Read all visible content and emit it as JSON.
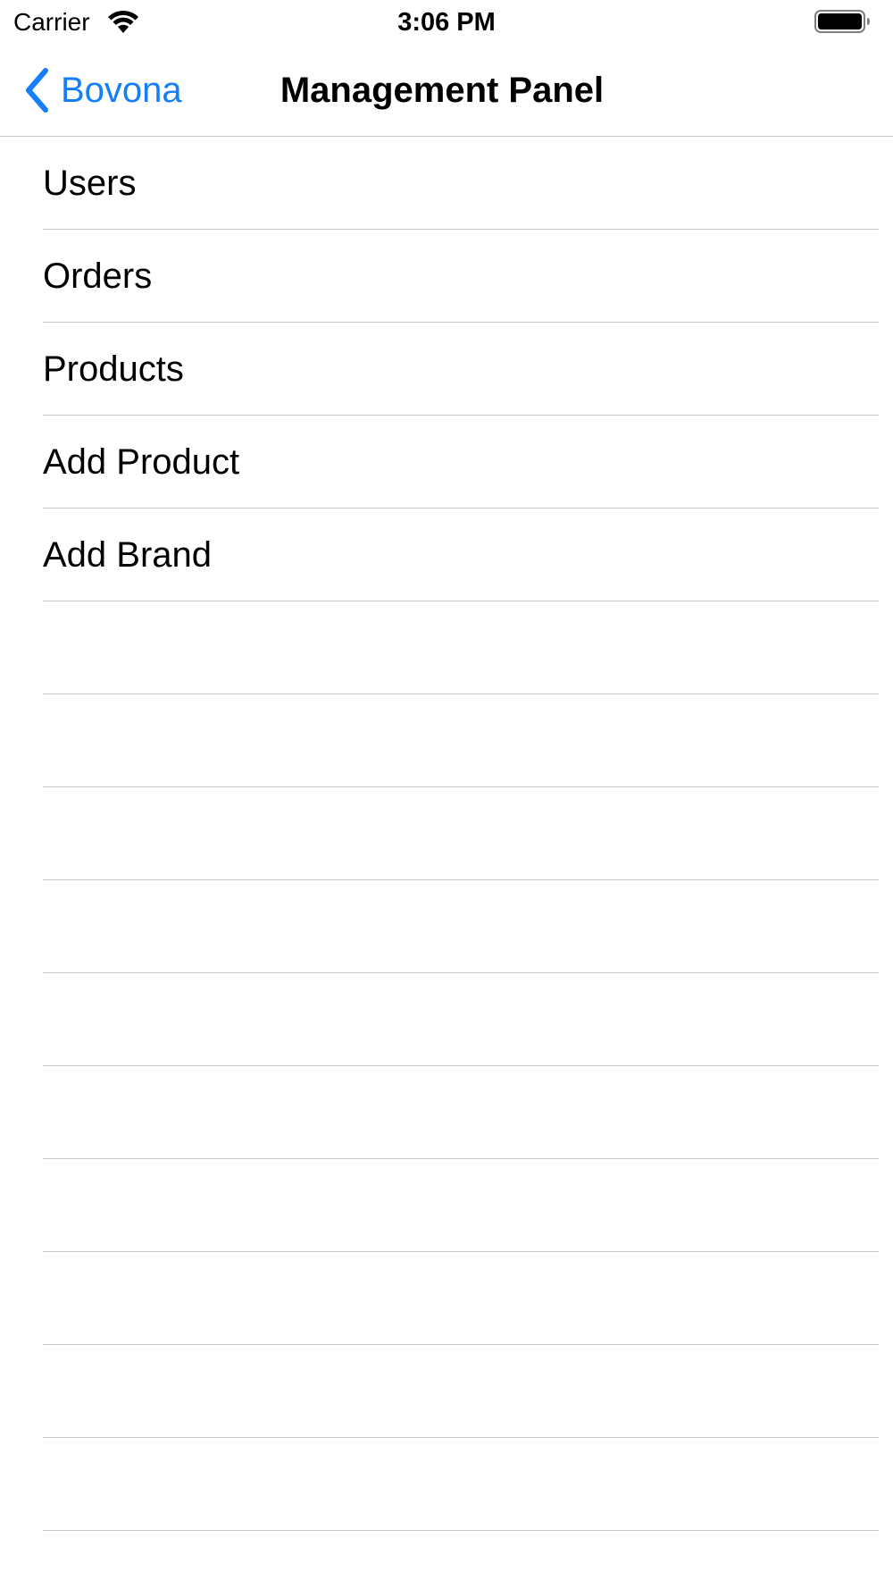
{
  "status_bar": {
    "carrier": "Carrier",
    "time": "3:06 PM",
    "icons": [
      "wifi-icon",
      "battery-icon"
    ]
  },
  "nav": {
    "back_label": "Bovona",
    "title": "Management Panel",
    "accent_color": "#147efb"
  },
  "menu": {
    "items": [
      {
        "label": "Users"
      },
      {
        "label": "Orders"
      },
      {
        "label": "Products"
      },
      {
        "label": "Add Product"
      },
      {
        "label": "Add Brand"
      }
    ],
    "empty_rows": 10
  }
}
